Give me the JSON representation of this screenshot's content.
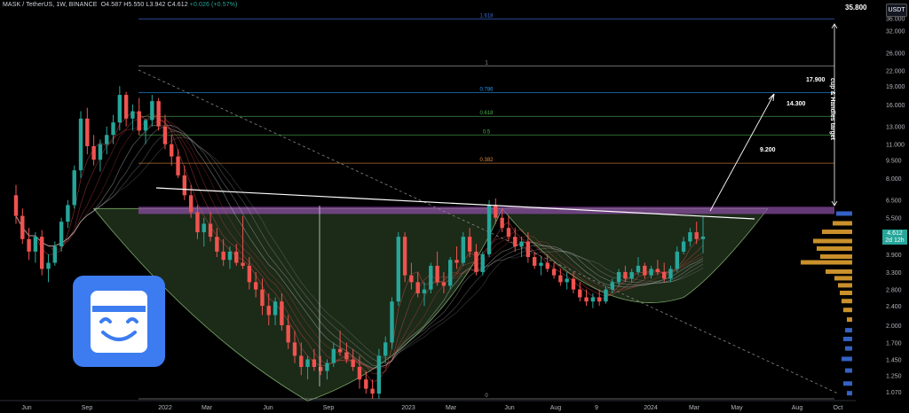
{
  "header": {
    "symbol": "MASK / TetherUS, 1W, BINANCE",
    "o": "O4.587",
    "h": "H5.550",
    "l": "L3.942",
    "c": "C4.612",
    "change": "+0.026 (+0.57%)"
  },
  "currency_button": "USDT",
  "top_price_label": "35.800",
  "last_price": {
    "price": "4.612",
    "countdown": "2d 12h"
  },
  "colors": {
    "background": "#000000",
    "up_candle": "#26a69a",
    "down_candle": "#ef5350",
    "cup_fill": "#1e2d1a",
    "resistance_zone": "#8e4ea8",
    "neckline": "#ffffff",
    "fib_line": "#9e9e9e",
    "fib_0786": "#2196f3",
    "fib_0382": "#e08a3c",
    "volume_profile": "#e0a030",
    "volume_profile_blue": "#3a6bd8"
  },
  "chart_data": {
    "type": "candlestick",
    "scale": "log",
    "ylim": [
      1.0,
      40.0
    ],
    "y_ticks": [
      "36.000",
      "32.000",
      "26.000",
      "22.000",
      "19.000",
      "16.000",
      "13.000",
      "11.000",
      "9.500",
      "8.000",
      "6.500",
      "5.500",
      "4.600",
      "3.900",
      "3.300",
      "2.800",
      "2.400",
      "2.000",
      "1.700",
      "1.450",
      "1.250",
      "1.070"
    ],
    "x_ticks": [
      "Jun",
      "Sep",
      "2022",
      "Mar",
      "Jun",
      "Sep",
      "2023",
      "Mar",
      "Jun",
      "Aug",
      "9",
      "2024",
      "Mar",
      "May",
      "Aug",
      "Oct"
    ],
    "fib_levels": [
      {
        "label": "1.618",
        "price": 35.8
      },
      {
        "label": "1",
        "price": 23.0
      },
      {
        "label": "0.786",
        "price": 17.9
      },
      {
        "label": "0.618",
        "price": 14.3
      },
      {
        "label": "0.5",
        "price": 12.0
      },
      {
        "label": "0.382",
        "price": 9.2
      },
      {
        "label": "0",
        "price": 1.0
      }
    ],
    "annotations": {
      "vertical_label": "cup & Handles target",
      "targets": [
        "17.900",
        "14.300",
        "9.200"
      ],
      "resistance_zone": [
        5.7,
        6.1
      ]
    },
    "series_description": "MASK weekly candles with EMA ribbon, cup and handle pattern",
    "candles_ohlc_approx": [
      [
        6.8,
        7.5,
        5.2,
        5.6
      ],
      [
        5.6,
        6.0,
        4.3,
        4.5
      ],
      [
        4.5,
        5.0,
        3.7,
        4.0
      ],
      [
        4.0,
        4.8,
        3.6,
        4.6
      ],
      [
        4.6,
        4.9,
        3.2,
        3.4
      ],
      [
        3.4,
        3.9,
        3.0,
        3.6
      ],
      [
        3.6,
        4.4,
        3.5,
        4.2
      ],
      [
        4.2,
        5.5,
        4.0,
        5.3
      ],
      [
        5.3,
        6.5,
        5.0,
        6.2
      ],
      [
        6.2,
        9.0,
        6.0,
        8.6
      ],
      [
        8.6,
        15.0,
        8.0,
        14.0
      ],
      [
        14.0,
        15.5,
        10.0,
        10.8
      ],
      [
        10.8,
        12.0,
        9.0,
        9.5
      ],
      [
        9.5,
        11.5,
        8.5,
        11.0
      ],
      [
        11.0,
        13.0,
        10.0,
        12.0
      ],
      [
        12.0,
        14.5,
        11.0,
        13.5
      ],
      [
        13.5,
        19.0,
        12.5,
        17.5
      ],
      [
        17.5,
        18.0,
        13.0,
        14.0
      ],
      [
        14.0,
        16.0,
        12.5,
        15.0
      ],
      [
        15.0,
        17.0,
        12.0,
        12.5
      ],
      [
        12.5,
        14.0,
        11.0,
        13.8
      ],
      [
        13.8,
        17.5,
        13.0,
        16.5
      ],
      [
        16.5,
        17.0,
        12.5,
        13.0
      ],
      [
        13.0,
        14.5,
        10.5,
        11.0
      ],
      [
        11.0,
        12.0,
        9.0,
        9.8
      ],
      [
        9.8,
        10.5,
        8.0,
        8.2
      ],
      [
        8.2,
        9.0,
        6.5,
        6.8
      ],
      [
        6.8,
        7.5,
        5.5,
        5.8
      ],
      [
        5.8,
        6.2,
        4.5,
        4.8
      ],
      [
        4.8,
        5.5,
        4.2,
        5.2
      ],
      [
        5.2,
        5.8,
        4.4,
        4.6
      ],
      [
        4.6,
        5.0,
        3.8,
        4.0
      ],
      [
        4.0,
        4.5,
        3.5,
        3.7
      ],
      [
        3.7,
        4.2,
        3.4,
        4.0
      ],
      [
        4.0,
        4.3,
        3.5,
        3.6
      ],
      [
        3.6,
        5.6,
        3.4,
        3.5
      ],
      [
        3.5,
        3.8,
        2.8,
        3.0
      ],
      [
        3.0,
        3.3,
        2.6,
        2.8
      ],
      [
        2.8,
        3.1,
        2.2,
        2.4
      ],
      [
        2.4,
        2.7,
        2.0,
        2.2
      ],
      [
        2.2,
        2.6,
        2.0,
        2.5
      ],
      [
        2.5,
        2.7,
        1.9,
        2.0
      ],
      [
        2.0,
        2.2,
        1.6,
        1.7
      ],
      [
        1.7,
        1.9,
        1.4,
        1.5
      ],
      [
        1.5,
        1.7,
        1.25,
        1.35
      ],
      [
        1.35,
        1.5,
        1.2,
        1.45
      ],
      [
        1.45,
        1.6,
        1.3,
        1.35
      ],
      [
        1.35,
        1.5,
        1.25,
        1.3
      ],
      [
        1.3,
        1.45,
        1.2,
        1.4
      ],
      [
        1.4,
        1.7,
        1.35,
        1.6
      ],
      [
        1.6,
        1.9,
        1.5,
        1.55
      ],
      [
        1.55,
        1.7,
        1.4,
        1.45
      ],
      [
        1.45,
        1.6,
        1.3,
        1.35
      ],
      [
        1.35,
        1.5,
        1.1,
        1.2
      ],
      [
        1.2,
        1.3,
        1.05,
        1.1
      ],
      [
        1.1,
        1.2,
        1.0,
        1.05
      ],
      [
        1.05,
        1.6,
        1.0,
        1.5
      ],
      [
        1.5,
        1.8,
        1.4,
        1.7
      ],
      [
        1.7,
        2.6,
        1.6,
        2.5
      ],
      [
        2.5,
        4.8,
        2.4,
        4.6
      ],
      [
        4.6,
        4.8,
        3.0,
        3.2
      ],
      [
        3.2,
        3.6,
        2.8,
        3.0
      ],
      [
        3.0,
        3.3,
        2.6,
        2.7
      ],
      [
        2.7,
        3.0,
        2.4,
        2.8
      ],
      [
        2.8,
        3.6,
        2.7,
        3.5
      ],
      [
        3.5,
        4.0,
        2.9,
        3.0
      ],
      [
        3.0,
        3.3,
        2.7,
        2.9
      ],
      [
        2.9,
        3.8,
        2.8,
        3.7
      ],
      [
        3.7,
        4.2,
        3.4,
        3.6
      ],
      [
        3.6,
        4.8,
        3.5,
        4.6
      ],
      [
        4.6,
        5.0,
        3.8,
        4.0
      ],
      [
        4.0,
        4.3,
        3.2,
        3.3
      ],
      [
        3.3,
        4.0,
        3.2,
        3.9
      ],
      [
        3.9,
        6.5,
        3.8,
        6.2
      ],
      [
        6.2,
        6.6,
        5.2,
        5.5
      ],
      [
        5.5,
        6.0,
        4.8,
        5.0
      ],
      [
        5.0,
        5.6,
        4.4,
        4.6
      ],
      [
        4.6,
        5.0,
        4.0,
        4.2
      ],
      [
        4.2,
        4.6,
        3.8,
        4.4
      ],
      [
        4.4,
        4.8,
        3.6,
        3.8
      ],
      [
        3.8,
        4.0,
        3.4,
        3.5
      ],
      [
        3.5,
        3.8,
        3.2,
        3.6
      ],
      [
        3.6,
        3.9,
        3.3,
        3.4
      ],
      [
        3.4,
        3.6,
        3.1,
        3.2
      ],
      [
        3.2,
        3.4,
        2.9,
        3.0
      ],
      [
        3.0,
        3.3,
        2.8,
        3.1
      ],
      [
        3.1,
        3.3,
        2.7,
        2.8
      ],
      [
        2.8,
        3.0,
        2.5,
        2.6
      ],
      [
        2.6,
        2.8,
        2.4,
        2.5
      ],
      [
        2.5,
        2.7,
        2.35,
        2.6
      ],
      [
        2.6,
        2.8,
        2.4,
        2.5
      ],
      [
        2.5,
        2.9,
        2.45,
        2.8
      ],
      [
        2.8,
        3.1,
        2.7,
        3.0
      ],
      [
        3.0,
        3.4,
        2.9,
        3.3
      ],
      [
        3.3,
        3.5,
        3.0,
        3.1
      ],
      [
        3.1,
        3.4,
        3.0,
        3.3
      ],
      [
        3.3,
        3.8,
        3.2,
        3.5
      ],
      [
        3.5,
        3.6,
        3.1,
        3.2
      ],
      [
        3.2,
        3.5,
        3.1,
        3.4
      ],
      [
        3.4,
        3.7,
        3.2,
        3.3
      ],
      [
        3.3,
        3.6,
        3.0,
        3.1
      ],
      [
        3.1,
        3.5,
        3.0,
        3.4
      ],
      [
        3.4,
        4.2,
        3.3,
        4.0
      ],
      [
        4.0,
        4.6,
        3.9,
        4.4
      ],
      [
        4.4,
        5.0,
        4.2,
        4.8
      ],
      [
        4.8,
        5.3,
        4.3,
        4.5
      ],
      [
        4.5,
        5.55,
        3.94,
        4.61
      ]
    ]
  }
}
